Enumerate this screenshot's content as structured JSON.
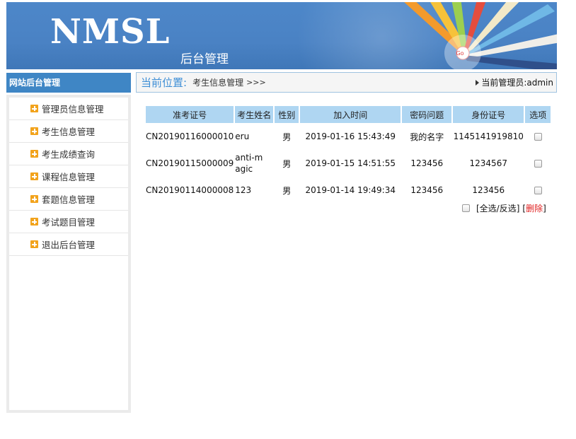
{
  "header": {
    "logo": "NMSL",
    "subtitle": "后台管理",
    "go_badge": "Go"
  },
  "sidebar": {
    "title": "网站后台管理",
    "items": [
      {
        "label": "管理员信息管理"
      },
      {
        "label": "考生信息管理"
      },
      {
        "label": "考生成绩查询"
      },
      {
        "label": "课程信息管理"
      },
      {
        "label": "套题信息管理"
      },
      {
        "label": "考试题目管理"
      },
      {
        "label": "退出后台管理"
      }
    ]
  },
  "location": {
    "label": "当前位置:",
    "value": "考生信息管理",
    "separator": ">>>",
    "admin_label": "当前管理员:",
    "admin_name": "admin"
  },
  "table": {
    "headers": [
      "准考证号",
      "考生姓名",
      "性别",
      "加入时间",
      "密码问题",
      "身份证号",
      "选项"
    ],
    "rows": [
      {
        "id": "CN20190116000010",
        "name": "eru",
        "gender": "男",
        "joined": "2019-01-16 15:43:49",
        "question": "我的名字",
        "id_card": "1145141919810"
      },
      {
        "id": "CN20190115000009",
        "name": "anti-magic",
        "gender": "男",
        "joined": "2019-01-15 14:51:55",
        "question": "123456",
        "id_card": "1234567"
      },
      {
        "id": "CN20190114000008",
        "name": "123",
        "gender": "男",
        "joined": "2019-01-14 19:49:34",
        "question": "123456",
        "id_card": "123456"
      }
    ]
  },
  "actions": {
    "select_all": "[全选/反选]",
    "delete_open": "[",
    "delete": "删除",
    "delete_close": "]"
  },
  "colors": {
    "banner": "#4a82c4",
    "sidebar_head": "#3f86c5",
    "table_header": "#afd6f2",
    "location_label": "#3f8fd6",
    "menu_icon": "#f2a31c",
    "delete_link": "#e02020"
  }
}
